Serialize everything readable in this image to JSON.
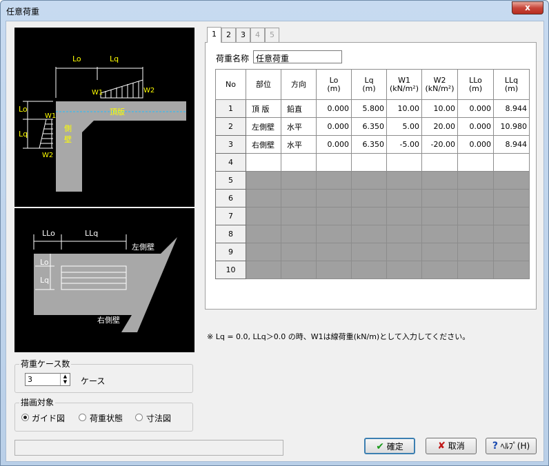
{
  "window": {
    "title": "任意荷重",
    "close_label": "x"
  },
  "diagram_top": {
    "dim_lo": "Lo",
    "dim_lq": "Lq",
    "w1": "W1",
    "w2": "W2",
    "lbl_lo": "Lo",
    "lbl_lq": "Lq",
    "lbl_w1": "W1",
    "lbl_w2": "W2",
    "top_slab": "頂版",
    "side_wall": "側壁"
  },
  "diagram_plan": {
    "dim_llo": "LLo",
    "dim_llq": "LLq",
    "left_wall": "左側壁",
    "right_wall": "右側壁",
    "lbl_lo": "Lo",
    "lbl_lq": "Lq"
  },
  "tabs": [
    {
      "label": "1",
      "active": true,
      "enabled": true
    },
    {
      "label": "2",
      "active": false,
      "enabled": true
    },
    {
      "label": "3",
      "active": false,
      "enabled": true
    },
    {
      "label": "4",
      "active": false,
      "enabled": false
    },
    {
      "label": "5",
      "active": false,
      "enabled": false
    }
  ],
  "load_name": {
    "label": "荷重名称",
    "value": "任意荷重"
  },
  "table": {
    "headers": [
      {
        "line1": "No",
        "line2": ""
      },
      {
        "line1": "部位",
        "line2": ""
      },
      {
        "line1": "方向",
        "line2": ""
      },
      {
        "line1": "Lo",
        "line2": "(m)"
      },
      {
        "line1": "Lq",
        "line2": "(m)"
      },
      {
        "line1": "W1",
        "line2": "(kN/m²)"
      },
      {
        "line1": "W2",
        "line2": "(kN/m²)"
      },
      {
        "line1": "LLo",
        "line2": "(m)"
      },
      {
        "line1": "LLq",
        "line2": "(m)"
      }
    ],
    "rows": [
      {
        "no": "1",
        "part": "頂 版",
        "dir": "鉛直",
        "lo": "0.000",
        "lq": "5.800",
        "w1": "10.00",
        "w2": "10.00",
        "llo": "0.000",
        "llq": "8.944"
      },
      {
        "no": "2",
        "part": "左側壁",
        "dir": "水平",
        "lo": "0.000",
        "lq": "6.350",
        "w1": "5.00",
        "w2": "20.00",
        "llo": "0.000",
        "llq": "10.980"
      },
      {
        "no": "3",
        "part": "右側壁",
        "dir": "水平",
        "lo": "0.000",
        "lq": "6.350",
        "w1": "-5.00",
        "w2": "-20.00",
        "llo": "0.000",
        "llq": "8.944"
      },
      {
        "no": "4",
        "part": "",
        "dir": "",
        "lo": "",
        "lq": "",
        "w1": "",
        "w2": "",
        "llo": "",
        "llq": ""
      },
      {
        "no": "5"
      },
      {
        "no": "6"
      },
      {
        "no": "7"
      },
      {
        "no": "8"
      },
      {
        "no": "9"
      },
      {
        "no": "10"
      }
    ]
  },
  "note": "※ Lq = 0.0, LLq＞0.0 の時、W1は線荷重(kN/m)として入力してください。",
  "case_count": {
    "group_label": "荷重ケース数",
    "value": "3",
    "unit": "ケース"
  },
  "draw_target": {
    "group_label": "描画対象",
    "options": [
      {
        "label": "ガイド図",
        "selected": true
      },
      {
        "label": "荷重状態",
        "selected": false
      },
      {
        "label": "寸法図",
        "selected": false
      }
    ]
  },
  "buttons": {
    "ok": "確定",
    "cancel": "取消",
    "help": "ﾍﾙﾌﾟ(H)"
  },
  "status_text": ""
}
